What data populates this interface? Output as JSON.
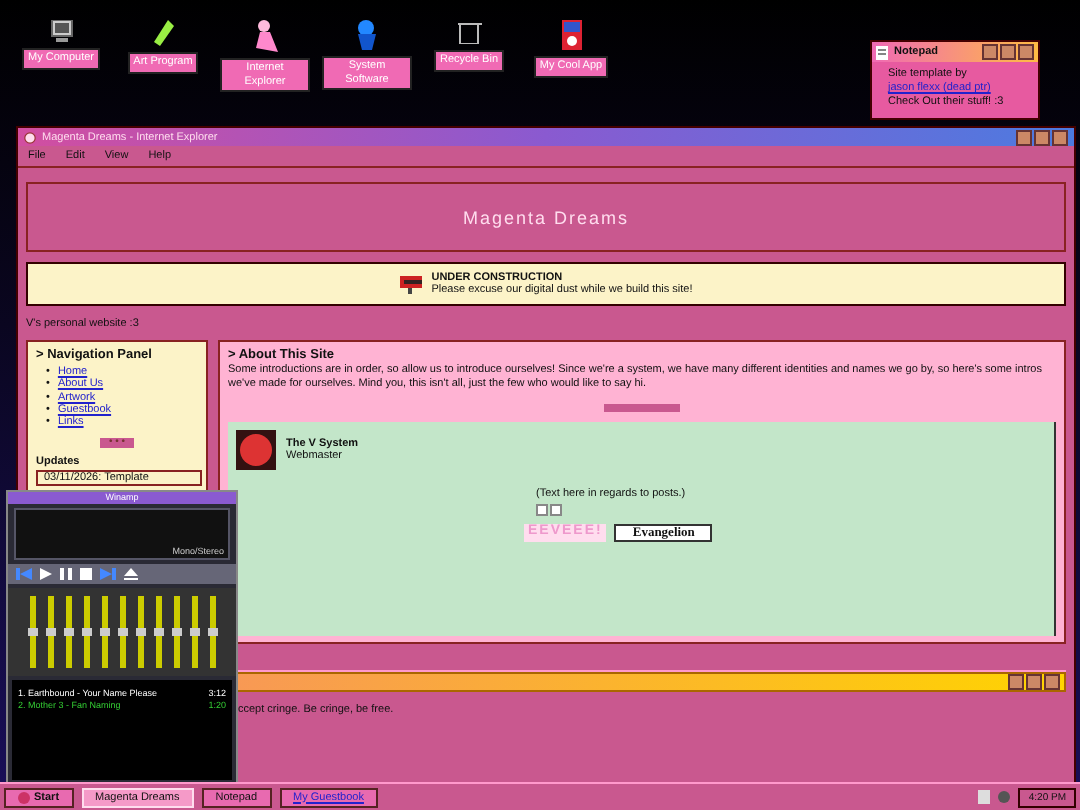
{
  "desktop_icons": [
    {
      "label": "My Computer"
    },
    {
      "label": "Art Program"
    },
    {
      "label": "Internet Explorer"
    },
    {
      "label": "System Software"
    },
    {
      "label": "Recycle Bin"
    },
    {
      "label": "My Cool App"
    }
  ],
  "notepad": {
    "title": "Notepad",
    "text": "Site template by",
    "link": "jason flexx (dead ptr)",
    "note": "Check Out their stuff! :3"
  },
  "browser": {
    "title": "Magenta Dreams - Internet Explorer",
    "menu": [
      "File",
      "Edit",
      "View",
      "Help"
    ],
    "banner": "Magenta Dreams",
    "notice": {
      "title": "UNDER CONSTRUCTION",
      "text": "Please excuse our digital dust while we build this site!"
    },
    "tagline": "V's personal website :3",
    "nav": {
      "title": "> Navigation Panel",
      "links": [
        {
          "marker": "•",
          "label": "Home"
        },
        {
          "marker": "•",
          "label": "About Us"
        },
        {
          "marker": "•",
          "label": "Artwork"
        },
        {
          "marker": "•",
          "label": "Guestbook"
        },
        {
          "marker": "•",
          "label": "Links"
        }
      ],
      "divider": "• • •",
      "updates_title": "Updates",
      "update": "03/11/2026: Template"
    },
    "about": {
      "title": "> About This Site",
      "text": "Some introductions are in order, so allow us to introduce ourselves! Since we're a system, we have many different identities and names we go by, so here's some intros we've made for ourselves. Mind you, this isn't all, just the few who would like to say hi.",
      "member": {
        "name": "The V System",
        "role": "Webmaster"
      },
      "post": "(Text here in regards to posts.)",
      "badges": [
        {
          "kind": "eevee",
          "text": "EEVEEE!"
        },
        {
          "kind": "eva",
          "text": "Evangelion"
        }
      ]
    },
    "lower_window": {
      "text": "ccept cringe. Be cringe, be free."
    }
  },
  "winamp": {
    "title": "Winamp",
    "mode": "Mono/Stereo",
    "eq": [
      {
        "level": 0.5
      },
      {
        "level": 0.5
      },
      {
        "level": 0.5
      },
      {
        "level": 0.5
      },
      {
        "level": 0.5
      },
      {
        "level": 0.5
      },
      {
        "level": 0.5
      },
      {
        "level": 0.5
      },
      {
        "level": 0.5
      },
      {
        "level": 0.5
      },
      {
        "level": 0.5
      }
    ],
    "tracks": [
      {
        "title": "1. Earthbound - Your Name Please",
        "time": "3:12",
        "selected": false
      },
      {
        "title": "2. Mother 3 - Fan Naming",
        "time": "1:20",
        "selected": true
      }
    ]
  },
  "taskbar": {
    "start": "Start",
    "tasks": [
      {
        "label": "Magenta Dreams",
        "kind": "window",
        "selected": true
      },
      {
        "label": "Notepad",
        "kind": "window",
        "selected": false
      },
      {
        "label": "My Guestbook",
        "kind": "link",
        "selected": false
      }
    ],
    "clock": "4:20 PM"
  }
}
